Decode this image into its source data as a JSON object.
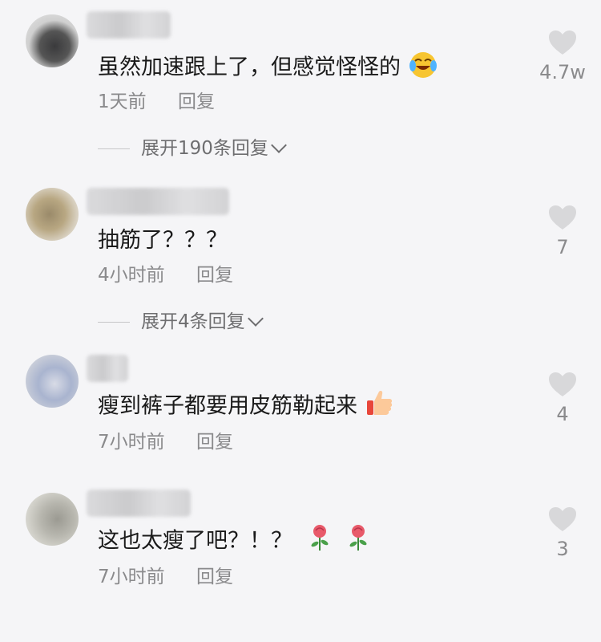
{
  "comments": [
    {
      "text": "虽然加速跟上了，但感觉怪怪的",
      "time": "1天前",
      "reply_label": "回复",
      "likes": "4.7w",
      "expand_label": "展开190条回复",
      "emoji": "crying-laughing-face-icon"
    },
    {
      "text": "抽筋了？？？",
      "time": "4小时前",
      "reply_label": "回复",
      "likes": "7",
      "expand_label": "展开4条回复"
    },
    {
      "text": "瘦到裤子都要用皮筋勒起来",
      "time": "7小时前",
      "reply_label": "回复",
      "likes": "4",
      "emoji": "thumbs-up-icon"
    },
    {
      "text": "这也太瘦了吧？！？",
      "time": "7小时前",
      "reply_label": "回复",
      "likes": "3",
      "emoji": "rose-icon"
    }
  ],
  "colors": {
    "background": "#f5f5f7",
    "text": "#1a1a1a",
    "meta": "#8a8a8c",
    "heart": "#d8d8da"
  }
}
